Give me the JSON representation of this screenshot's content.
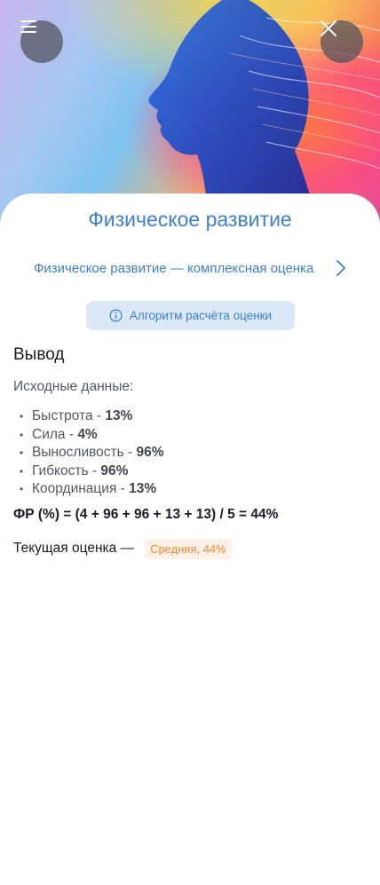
{
  "header": {
    "menu_icon": "hamburger-menu-icon",
    "close_icon": "close-icon"
  },
  "page": {
    "title": "Физическое развитие",
    "nav_link": "Физическое развитие — комплексная оценка",
    "algorithm_button": "Алгоритм расчёта оценки",
    "conclusion_title": "Вывод",
    "source_data_label": "Исходные данные:",
    "parameters": [
      {
        "name": "Быстрота",
        "sep": " - ",
        "value": "13%"
      },
      {
        "name": "Сила",
        "sep": " - ",
        "value": "4%"
      },
      {
        "name": "Выносливость",
        "sep": " - ",
        "value": "96%"
      },
      {
        "name": "Гибкость",
        "sep": " - ",
        "value": "96%"
      },
      {
        "name": "Координация",
        "sep": " - ",
        "value": "13%"
      }
    ],
    "formula": "ФР (%) = (4 + 96 + 96 + 13 + 13) / 5 = 44%",
    "current_label": "Текущая оценка —",
    "current_badge": "Средняя, 44%"
  },
  "colors": {
    "accent": "#3e7fd0",
    "badge_text": "#f0893a",
    "badge_bg": "#fdf1e6",
    "algo_bg": "#dbe8f8"
  }
}
